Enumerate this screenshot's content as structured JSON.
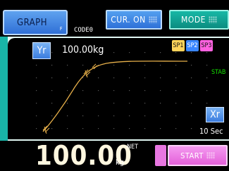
{
  "header": {
    "graph_label": "GRAPH",
    "graph_sub": "F",
    "code_label": "CODE0",
    "cur_label": "CUR. ON",
    "mode_label": "MODE"
  },
  "graph": {
    "y_axis_button": "Yr",
    "y_value": "100.00kg",
    "setpoints": [
      "SP1",
      "SP2",
      "SP3"
    ],
    "status": "STAB",
    "x_axis_button": "Xr",
    "x_range": "10 Sec",
    "curve_color": "#e7b04a"
  },
  "footer": {
    "weight": "100.00",
    "unit": "kg",
    "net_label": "NET",
    "start_label": "START"
  }
}
